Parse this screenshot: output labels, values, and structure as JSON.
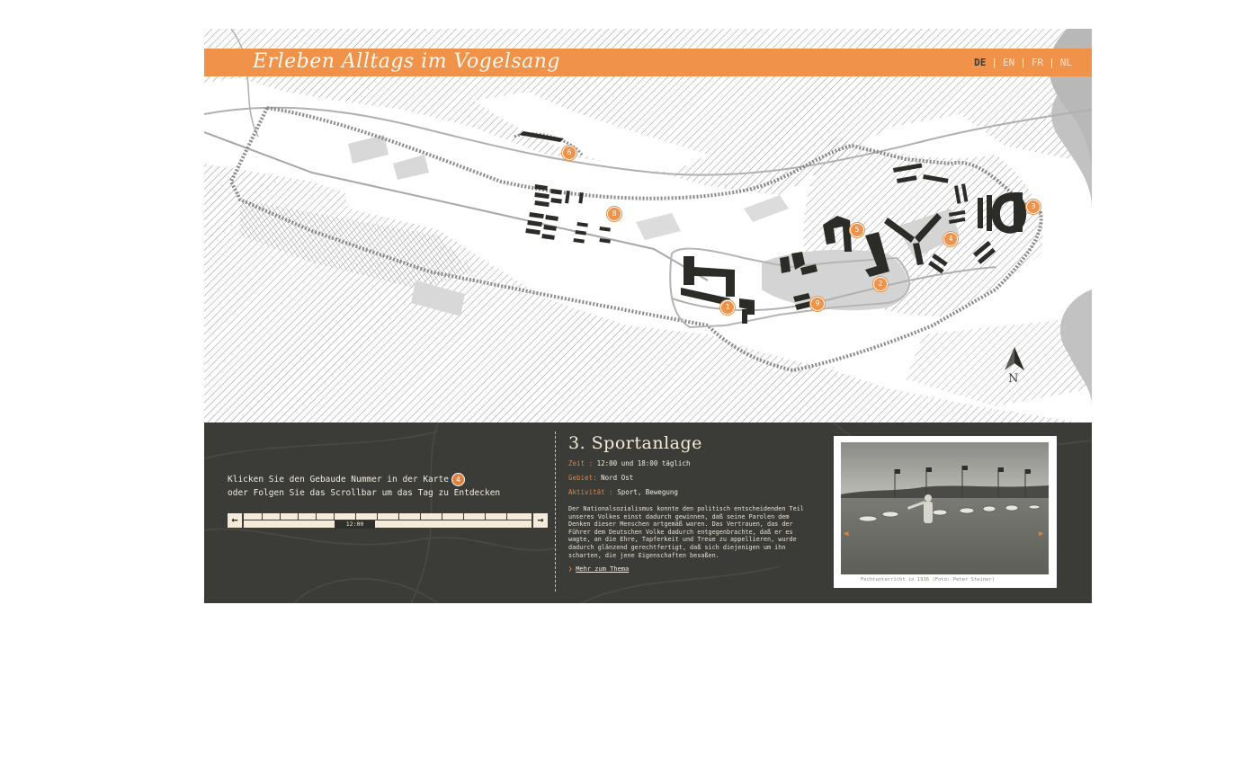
{
  "header": {
    "title": "Erleben Alltags im Vogelsang",
    "languages": [
      {
        "code": "DE",
        "active": true
      },
      {
        "code": "EN",
        "active": false
      },
      {
        "code": "FR",
        "active": false
      },
      {
        "code": "NL",
        "active": false
      }
    ],
    "separator": "|"
  },
  "map": {
    "markers": [
      "1",
      "2",
      "3",
      "4",
      "5",
      "6",
      "7",
      "8",
      "9"
    ],
    "compass_label": "N"
  },
  "panel": {
    "instruction_line1": "Klicken Sie den Gebaude Nummer in der Karte",
    "instruction_badge": "4",
    "instruction_line2": "oder Folgen Sie das Scrollbar um das Tag zu Entdecken",
    "timeline": {
      "left_arrow": "←",
      "right_arrow": "→",
      "current_time": "12:00"
    },
    "title": "3. Sportanlage",
    "zeit_label": "Zeit :",
    "zeit_value": "12:00 und 18:00 täglich",
    "gebiet_label": "Gebiet:",
    "gebiet_value": "Nord Ost",
    "aktivitat_label": "Aktivität :",
    "aktivitat_value": "Sport, Bewegung",
    "body": "Der Nationalsozialismus konnte den politisch entscheidenden Teil unseres Volkes einst dadurch gewinnen, daß seine Parolen dem Denken dieser Menschen artgemäß waren. Das Vertrauen, das der Führer dem Deutschen Volke dadurch entgegenbrachte, daß er es wagte, an die Ehre, Tapferkeit und Treue zu appellieren, wurde dadurch glänzend gerechtfertigt, daß sich diejenigen um ihn scharten, die jene Eigenschaften besaßen.",
    "more_chevron": "❯",
    "more_label": "Mehr zum Thema",
    "photo_prev": "◀",
    "photo_next": "▶",
    "photo_caption": "Fechtunterricht in 1936 (Foto: Peter Steiner)"
  },
  "colors": {
    "accent": "#f0924a",
    "panel_bg": "#3b3b37",
    "cream": "#f4ecd8"
  }
}
